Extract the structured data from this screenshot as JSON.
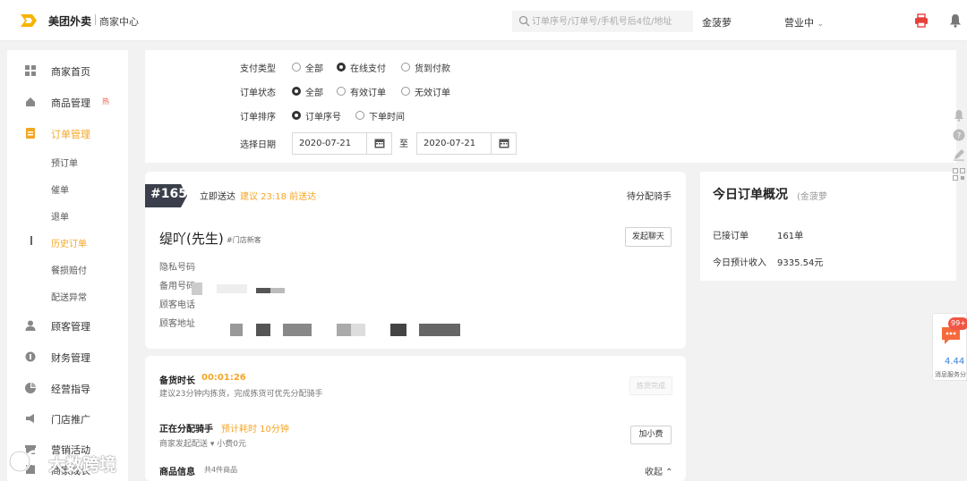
{
  "header": {
    "brand": "美团外卖",
    "brand_sub": "商家中心",
    "search_placeholder": "订单序号/订单号/手机号后4位/地址",
    "username": "金菠萝",
    "status": "营业中",
    "status_caret": "⌄"
  },
  "sidebar": {
    "items": [
      {
        "label": "商家首页",
        "icon": "grid-icon"
      },
      {
        "label": "商品管理",
        "icon": "goods-icon",
        "hot": "热"
      },
      {
        "label": "订单管理",
        "icon": "order-icon"
      },
      {
        "label": "顾客管理",
        "icon": "user-icon"
      },
      {
        "label": "财务管理",
        "icon": "finance-icon"
      },
      {
        "label": "经营指导",
        "icon": "chart-icon"
      },
      {
        "label": "门店推广",
        "icon": "promote-icon"
      },
      {
        "label": "营销活动",
        "icon": "marketing-icon"
      },
      {
        "label": "商家成长",
        "icon": "growth-icon"
      }
    ],
    "sub_items": [
      "预订单",
      "催单",
      "退单",
      "历史订单",
      "餐损赔付",
      "配送异常"
    ]
  },
  "filter": {
    "pay_type": {
      "label": "支付类型",
      "options": [
        "全部",
        "在线支付",
        "货到付款"
      ],
      "selected": "在线支付"
    },
    "order_status": {
      "label": "订单状态",
      "options": [
        "全部",
        "有效订单",
        "无效订单"
      ],
      "selected": "全部"
    },
    "sort": {
      "label": "订单排序",
      "options": [
        "订单序号",
        "下单时间"
      ],
      "selected": "订单序号"
    },
    "date": {
      "label": "选择日期",
      "from": "2020-07-21",
      "to_label": "至",
      "to": "2020-07-21"
    }
  },
  "order": {
    "number": "#165",
    "deliver_now": "立即送达",
    "deliver_hint": "建议 23:18 前送达",
    "status": "待分配骑手",
    "customer_name": "缇吖(先生)",
    "customer_tag": "#门店新客",
    "chat_button": "发起聊天",
    "fields": [
      "隐私号码",
      "备用号码",
      "顾客电话",
      "顾客地址"
    ]
  },
  "prep": {
    "title": "备货时长",
    "time": "00:01:26",
    "hint": "建议23分钟内拣货，完成拣货可优先分配骑手",
    "button": "拣货完成",
    "rider_title": "正在分配骑手",
    "rider_est": "预计耗时 10分钟",
    "rider_sub": "商家发起配送 ▾ 小费0元",
    "tip_button": "加小费",
    "goods_title": "商品信息",
    "goods_count": "共4件商品",
    "collapse": "收起 ⌃"
  },
  "overview": {
    "title": "今日订单概况",
    "store": "(金菠萝",
    "received_label": "已接订单",
    "received_value": "161单",
    "income_label": "今日预计收入",
    "income_value": "9335.54元"
  },
  "service": {
    "badge": "99+",
    "score": "4.44",
    "label": "消息服务分"
  },
  "watermark": "大数跨境",
  "colors": {
    "accent": "#f5a623",
    "tag_bg": "#3a3f4b",
    "danger": "#f05545"
  }
}
